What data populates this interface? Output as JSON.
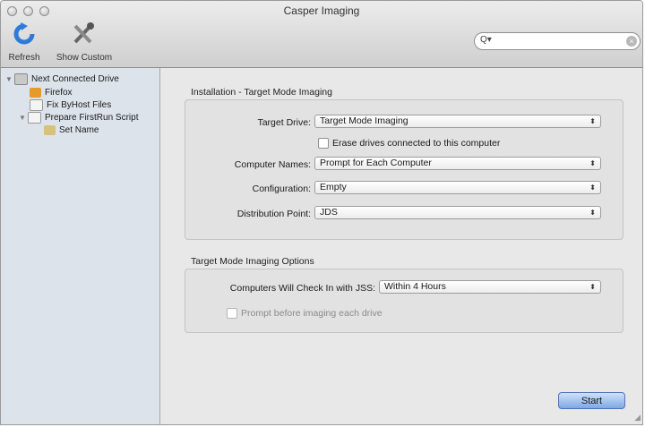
{
  "window": {
    "title": "Casper Imaging"
  },
  "toolbar": {
    "refresh_label": "Refresh",
    "show_custom_label": "Show Custom",
    "search_placeholder": ""
  },
  "sidebar": {
    "items": [
      {
        "label": "Next Connected Drive",
        "icon": "drive-icon"
      },
      {
        "label": "Firefox",
        "icon": "package-icon"
      },
      {
        "label": "Fix ByHost Files",
        "icon": "script-icon"
      },
      {
        "label": "Prepare FirstRun Script",
        "icon": "script-icon"
      },
      {
        "label": "Set Name",
        "icon": "name-icon"
      }
    ]
  },
  "installation": {
    "title": "Installation - Target Mode Imaging",
    "target_drive_label": "Target Drive:",
    "target_drive_value": "Target Mode Imaging",
    "erase_label": "Erase drives connected to this computer",
    "computer_names_label": "Computer Names:",
    "computer_names_value": "Prompt for Each Computer",
    "configuration_label": "Configuration:",
    "configuration_value": "Empty",
    "distribution_label": "Distribution Point:",
    "distribution_value": "JDS"
  },
  "options": {
    "title": "Target Mode Imaging Options",
    "checkin_label": "Computers Will Check In with JSS:",
    "checkin_value": "Within 4 Hours",
    "prompt_label": "Prompt before imaging each drive"
  },
  "actions": {
    "start_label": "Start"
  }
}
